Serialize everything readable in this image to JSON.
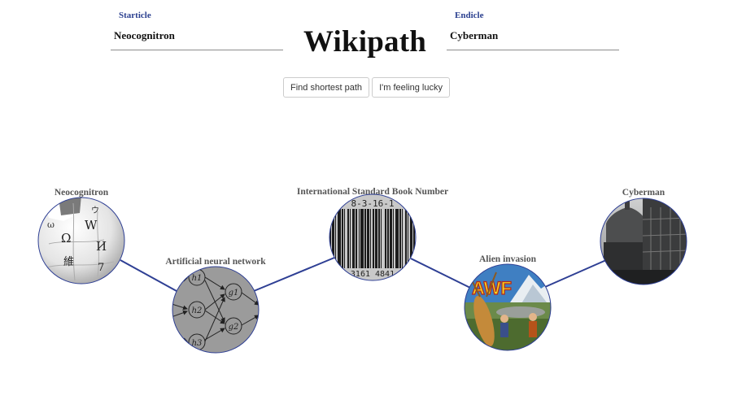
{
  "header": {
    "title": "Wikipath",
    "start": {
      "label": "Starticle",
      "value": "Neocognitron"
    },
    "end": {
      "label": "Endicle",
      "value": "Cyberman"
    }
  },
  "buttons": {
    "find": "Find shortest path",
    "lucky": "I'm feeling lucky"
  },
  "path": {
    "nodes": [
      {
        "title": "Neocognitron",
        "image": "wikipedia-globe-icon"
      },
      {
        "title": "Artificial neural network",
        "image": "neural-network-diagram"
      },
      {
        "title": "International Standard Book Number",
        "image": "barcode"
      },
      {
        "title": "Alien invasion",
        "image": "pulp-magazine-cover"
      },
      {
        "title": "Cyberman",
        "image": "london-street-photo"
      }
    ],
    "image_text": {
      "globe_glyphs": [
        "Ω",
        "W",
        "И",
        "維",
        "ウ",
        "ω",
        "7"
      ],
      "nn_labels": [
        "h1",
        "h2",
        "h3",
        "g1",
        "g2"
      ],
      "isbn_top": "8-3-16-1",
      "isbn_bottom": "3161 4841",
      "magazine": "AWF"
    }
  },
  "colors": {
    "accent": "#2a3f8f",
    "edge": "#2e3f94",
    "label": "#555555"
  }
}
